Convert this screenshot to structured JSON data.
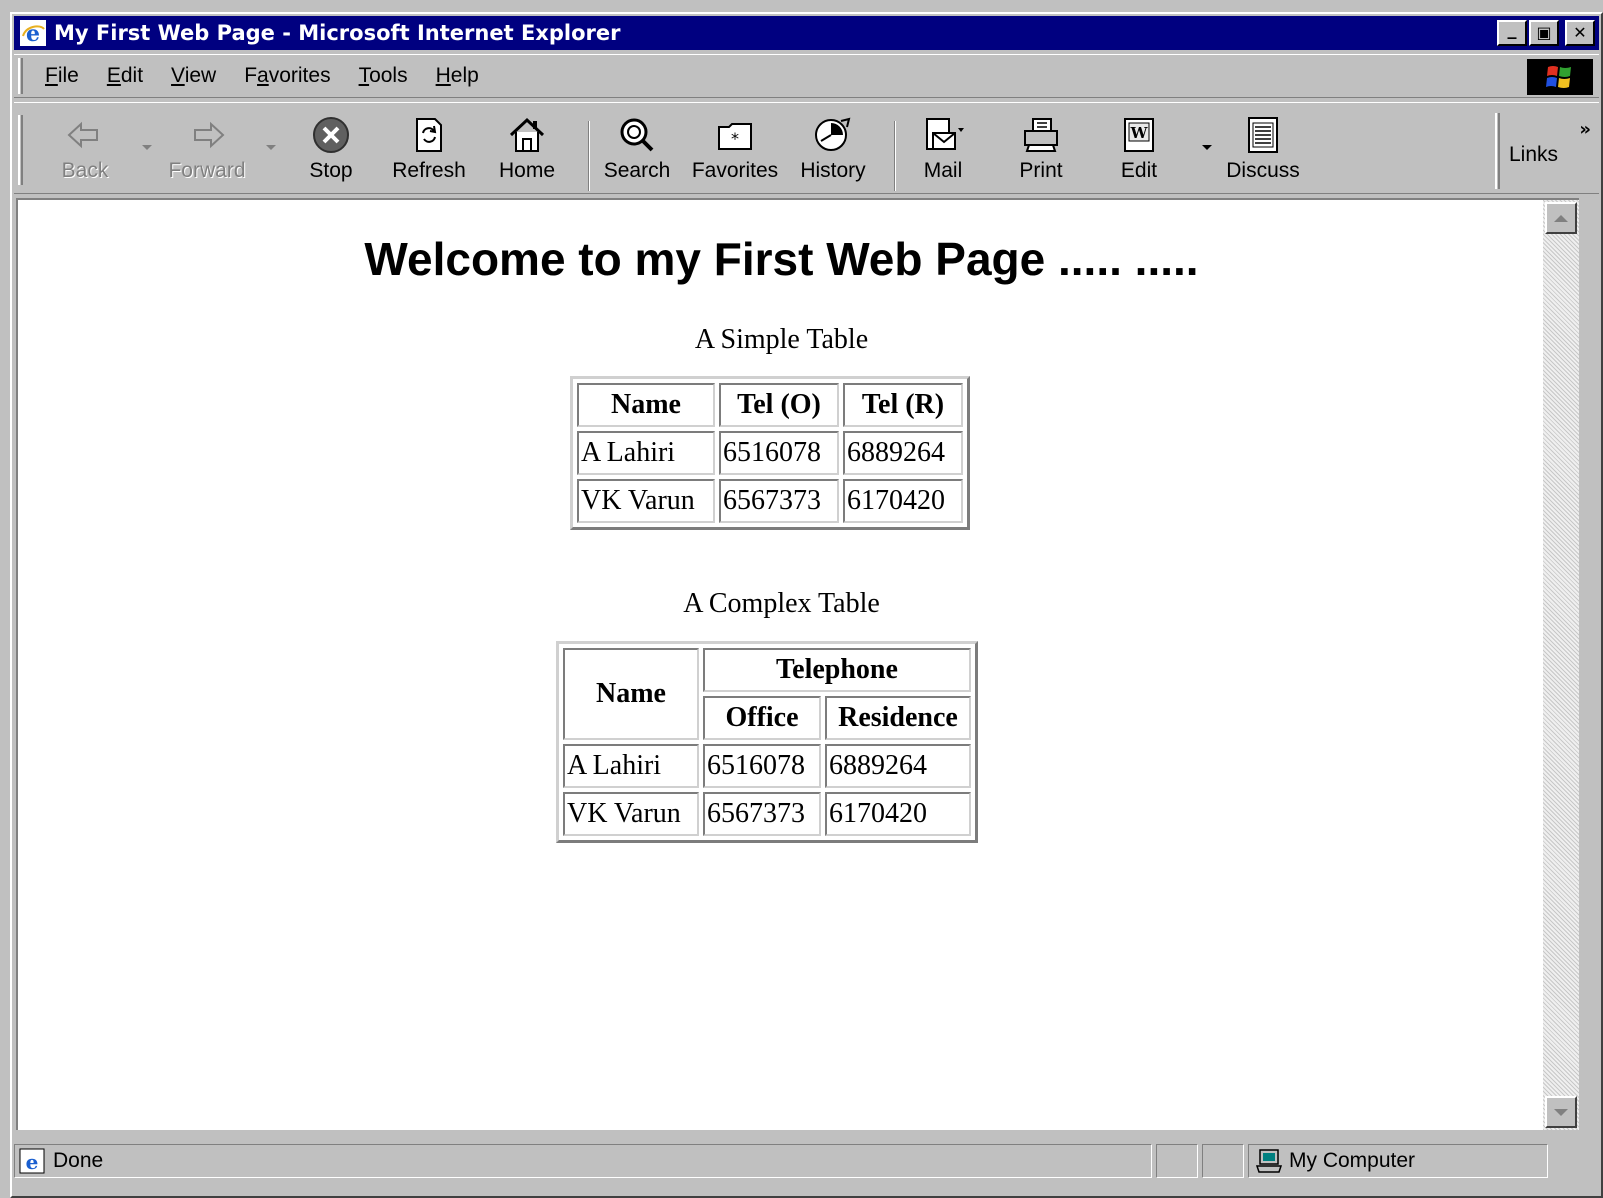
{
  "window": {
    "title": "My First Web Page - Microsoft Internet Explorer",
    "caption_buttons": {
      "minimize": "_",
      "maximize": "▣",
      "close": "✕"
    }
  },
  "menu": [
    {
      "pre": "",
      "key": "F",
      "post": "ile"
    },
    {
      "pre": "",
      "key": "E",
      "post": "dit"
    },
    {
      "pre": "",
      "key": "V",
      "post": "iew"
    },
    {
      "pre": "F",
      "key": "a",
      "post": "vorites"
    },
    {
      "pre": "",
      "key": "T",
      "post": "ools"
    },
    {
      "pre": "",
      "key": "H",
      "post": "elp"
    }
  ],
  "toolbar": {
    "back": "Back",
    "forward": "Forward",
    "stop": "Stop",
    "refresh": "Refresh",
    "home": "Home",
    "search": "Search",
    "favorites": "Favorites",
    "history": "History",
    "mail": "Mail",
    "print": "Print",
    "edit": "Edit",
    "discuss": "Discuss",
    "links": "Links",
    "chevron": "»"
  },
  "page": {
    "heading": "Welcome to my First Web Page ..... .....",
    "simple_table": {
      "caption": "A Simple Table",
      "headers": [
        "Name",
        "Tel (O)",
        "Tel (R)"
      ],
      "rows": [
        [
          "A Lahiri",
          "6516078",
          "6889264"
        ],
        [
          "VK Varun",
          "6567373",
          "6170420"
        ]
      ]
    },
    "complex_table": {
      "caption": "A Complex Table",
      "name_header": "Name",
      "group_header": "Telephone",
      "sub_headers": [
        "Office",
        "Residence"
      ],
      "rows": [
        [
          "A Lahiri",
          "6516078",
          "6889264"
        ],
        [
          "VK Varun",
          "6567373",
          "6170420"
        ]
      ]
    }
  },
  "status": {
    "text": "Done",
    "zone": "My Computer"
  }
}
